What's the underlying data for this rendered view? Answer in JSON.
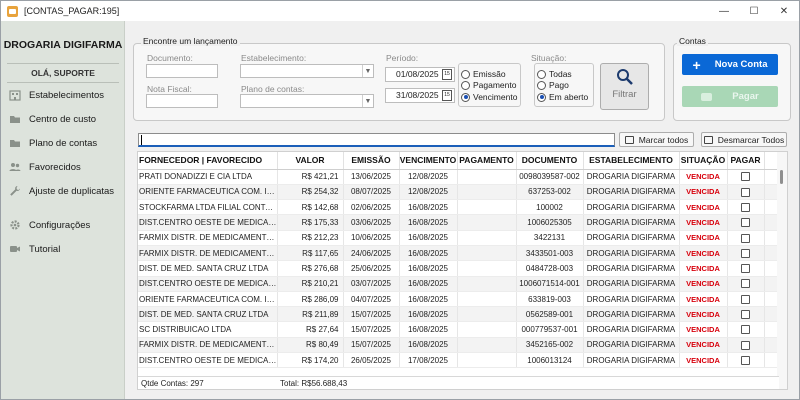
{
  "window": {
    "title": "[CONTAS_PAGAR:195]",
    "min": "—",
    "max": "☐",
    "close": "✕"
  },
  "sidebar": {
    "brand": "DROGARIA DIGIFARMA",
    "user": "OLÁ, SUPORTE",
    "items": [
      {
        "label": "Estabelecimentos",
        "icon": "building-icon"
      },
      {
        "label": "Centro de custo",
        "icon": "folder-icon"
      },
      {
        "label": "Plano de contas",
        "icon": "folder-icon"
      },
      {
        "label": "Favorecidos",
        "icon": "people-icon"
      },
      {
        "label": "Ajuste de duplicatas",
        "icon": "wrench-icon"
      },
      {
        "label": "Configurações",
        "icon": "gear-icon"
      },
      {
        "label": "Tutorial",
        "icon": "video-icon"
      }
    ]
  },
  "filters": {
    "group_title": "Encontre um lançamento",
    "documento_label": "Documento:",
    "nota_label": "Nota Fiscal:",
    "estab_label": "Estabelecimento:",
    "plano_label": "Plano de contas:",
    "periodo_label": "Período:",
    "date_from": "01/08/2025",
    "date_to": "31/08/2025",
    "radio_emissao": "Emissão",
    "radio_pagamento": "Pagamento",
    "radio_vencimento": "Vencimento",
    "situacao_label": "Situação:",
    "radio_todas": "Todas",
    "radio_pago": "Pago",
    "radio_aberto": "Em aberto",
    "filtrar": "Filtrar"
  },
  "contas": {
    "group_title": "Contas",
    "nova": "Nova Conta",
    "pagar": "Pagar"
  },
  "actions": {
    "marcar": "Marcar todos",
    "desmarcar": "Desmarcar Todos"
  },
  "grid": {
    "headers": {
      "fornecedor": "FORNECEDOR | FAVORECIDO",
      "valor": "VALOR",
      "emissao": "EMISSÃO",
      "vencimento": "VENCIMENTO",
      "pagamento": "PAGAMENTO",
      "documento": "DOCUMENTO",
      "estabelecimento": "ESTABELECIMENTO",
      "situacao": "SITUAÇÃO",
      "pagar": "PAGAR"
    },
    "rows": [
      {
        "fornecedor": "PRATI DONADIZZI E CIA LTDA",
        "valor": "R$ 421,21",
        "emissao": "13/06/2025",
        "vencimento": "12/08/2025",
        "pagamento": "",
        "documento": "0098039587-002",
        "estab": "DROGARIA DIGIFARMA",
        "situacao": "VENCIDA"
      },
      {
        "fornecedor": "ORIENTE FARMACEUTICA COM. IMP. ...",
        "valor": "R$ 254,32",
        "emissao": "08/07/2025",
        "vencimento": "12/08/2025",
        "pagamento": "",
        "documento": "637253-002",
        "estab": "DROGARIA DIGIFARMA",
        "situacao": "VENCIDA"
      },
      {
        "fornecedor": "STOCKFARMA LTDA  FILIAL CONTAGEM",
        "valor": "R$ 142,68",
        "emissao": "02/06/2025",
        "vencimento": "16/08/2025",
        "pagamento": "",
        "documento": "100002",
        "estab": "DROGARIA DIGIFARMA",
        "situacao": "VENCIDA"
      },
      {
        "fornecedor": "DIST.CENTRO OESTE DE MEDICAMENT...",
        "valor": "R$ 175,33",
        "emissao": "03/06/2025",
        "vencimento": "16/08/2025",
        "pagamento": "",
        "documento": "1006025305",
        "estab": "DROGARIA DIGIFARMA",
        "situacao": "VENCIDA"
      },
      {
        "fornecedor": "FARMIX DISTR. DE MEDICAMENTOS S/A",
        "valor": "R$ 212,23",
        "emissao": "10/06/2025",
        "vencimento": "16/08/2025",
        "pagamento": "",
        "documento": "3422131",
        "estab": "DROGARIA DIGIFARMA",
        "situacao": "VENCIDA"
      },
      {
        "fornecedor": "FARMIX DISTR. DE MEDICAMENTOS S/A",
        "valor": "R$ 117,65",
        "emissao": "24/06/2025",
        "vencimento": "16/08/2025",
        "pagamento": "",
        "documento": "3433501-003",
        "estab": "DROGARIA DIGIFARMA",
        "situacao": "VENCIDA"
      },
      {
        "fornecedor": "DIST. DE MED. SANTA CRUZ LTDA",
        "valor": "R$ 276,68",
        "emissao": "25/06/2025",
        "vencimento": "16/08/2025",
        "pagamento": "",
        "documento": "0484728-003",
        "estab": "DROGARIA DIGIFARMA",
        "situacao": "VENCIDA"
      },
      {
        "fornecedor": "DIST.CENTRO OESTE DE MEDICAMENT...",
        "valor": "R$ 210,21",
        "emissao": "03/07/2025",
        "vencimento": "16/08/2025",
        "pagamento": "",
        "documento": "1006071514-001",
        "estab": "DROGARIA DIGIFARMA",
        "situacao": "VENCIDA"
      },
      {
        "fornecedor": "ORIENTE FARMACEUTICA COM. IMP. ...",
        "valor": "R$ 286,09",
        "emissao": "04/07/2025",
        "vencimento": "16/08/2025",
        "pagamento": "",
        "documento": "633819-003",
        "estab": "DROGARIA DIGIFARMA",
        "situacao": "VENCIDA"
      },
      {
        "fornecedor": "DIST. DE MED. SANTA CRUZ LTDA",
        "valor": "R$ 211,89",
        "emissao": "15/07/2025",
        "vencimento": "16/08/2025",
        "pagamento": "",
        "documento": "0562589-001",
        "estab": "DROGARIA DIGIFARMA",
        "situacao": "VENCIDA"
      },
      {
        "fornecedor": "SC DISTRIBUICAO LTDA",
        "valor": "R$ 27,64",
        "emissao": "15/07/2025",
        "vencimento": "16/08/2025",
        "pagamento": "",
        "documento": "000779537-001",
        "estab": "DROGARIA DIGIFARMA",
        "situacao": "VENCIDA"
      },
      {
        "fornecedor": "FARMIX DISTR. DE MEDICAMENTOS S/A",
        "valor": "R$ 80,49",
        "emissao": "15/07/2025",
        "vencimento": "16/08/2025",
        "pagamento": "",
        "documento": "3452165-002",
        "estab": "DROGARIA DIGIFARMA",
        "situacao": "VENCIDA"
      },
      {
        "fornecedor": "DIST.CENTRO OESTE DE MEDICAMENT...",
        "valor": "R$ 174,20",
        "emissao": "26/05/2025",
        "vencimento": "17/08/2025",
        "pagamento": "",
        "documento": "1006013124",
        "estab": "DROGARIA DIGIFARMA",
        "situacao": "VENCIDA"
      }
    ],
    "footer_count": "Qtde Contas: 297",
    "footer_total": "Total: R$56.688,43"
  },
  "colors": {
    "accent": "#0a68d6",
    "pagar_disabled": "#a9d7b6",
    "vencida": "#d8000c",
    "sidebar_bg": "#dde3dc"
  }
}
